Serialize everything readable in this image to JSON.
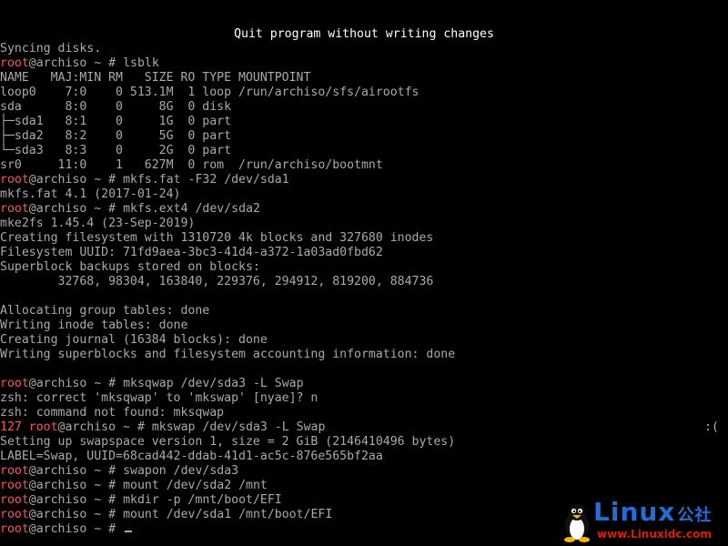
{
  "title": "Quit program without writing changes",
  "prompt": {
    "user": "root",
    "at_host": "@archiso",
    "tilde": "~",
    "symbol": "#"
  },
  "colors": {
    "background": "#000000",
    "text": "#aaaaaa",
    "title": "#ffffff",
    "root_user": "#ff5555",
    "exit_code": "#ff5555",
    "watermark_blue": "#1f6fd6",
    "watermark_red": "#d81e06"
  },
  "lines": [
    {
      "type": "out",
      "text": "Syncing disks."
    },
    {
      "type": "cmd",
      "cmd": "lsblk"
    },
    {
      "type": "out",
      "text": "NAME   MAJ:MIN RM   SIZE RO TYPE MOUNTPOINT"
    },
    {
      "type": "out",
      "text": "loop0    7:0    0 513.1M  1 loop /run/archiso/sfs/airootfs"
    },
    {
      "type": "out",
      "text": "sda      8:0    0     8G  0 disk"
    },
    {
      "type": "out",
      "text": "├─sda1   8:1    0     1G  0 part"
    },
    {
      "type": "out",
      "text": "├─sda2   8:2    0     5G  0 part"
    },
    {
      "type": "out",
      "text": "└─sda3   8:3    0     2G  0 part"
    },
    {
      "type": "out",
      "text": "sr0     11:0    1   627M  0 rom  /run/archiso/bootmnt"
    },
    {
      "type": "cmd",
      "cmd": "mkfs.fat -F32 /dev/sda1"
    },
    {
      "type": "out",
      "text": "mkfs.fat 4.1 (2017-01-24)"
    },
    {
      "type": "cmd",
      "cmd": "mkfs.ext4 /dev/sda2"
    },
    {
      "type": "out",
      "text": "mke2fs 1.45.4 (23-Sep-2019)"
    },
    {
      "type": "out",
      "text": "Creating filesystem with 1310720 4k blocks and 327680 inodes"
    },
    {
      "type": "out",
      "text": "Filesystem UUID: 71fd9aea-3bc3-41d4-a372-1a03ad0fbd62"
    },
    {
      "type": "out",
      "text": "Superblock backups stored on blocks:"
    },
    {
      "type": "out",
      "text": "        32768, 98304, 163840, 229376, 294912, 819200, 884736"
    },
    {
      "type": "out",
      "text": ""
    },
    {
      "type": "out",
      "text": "Allocating group tables: done"
    },
    {
      "type": "out",
      "text": "Writing inode tables: done"
    },
    {
      "type": "out",
      "text": "Creating journal (16384 blocks): done"
    },
    {
      "type": "out",
      "text": "Writing superblocks and filesystem accounting information: done"
    },
    {
      "type": "out",
      "text": ""
    },
    {
      "type": "cmd",
      "cmd": "mksqwap /dev/sda3 -L Swap"
    },
    {
      "type": "out",
      "text": "zsh: correct 'mksqwap' to 'mkswap' [nyae]? n"
    },
    {
      "type": "out",
      "text": "zsh: command not found: mksqwap"
    },
    {
      "type": "cmd",
      "code": "127",
      "cmd": "mkswap /dev/sda3 -L Swap",
      "rprompt": ":("
    },
    {
      "type": "out",
      "text": "Setting up swapspace version 1, size = 2 GiB (2146410496 bytes)"
    },
    {
      "type": "out",
      "text": "LABEL=Swap, UUID=68cad442-ddab-41d1-ac5c-876e565bf2aa"
    },
    {
      "type": "cmd",
      "cmd": "swapon /dev/sda3"
    },
    {
      "type": "cmd",
      "cmd": "mount /dev/sda2 /mnt"
    },
    {
      "type": "cmd",
      "cmd": "mkdir -p /mnt/boot/EFI"
    },
    {
      "type": "cmd",
      "cmd": "mount /dev/sda1 /mnt/boot/EFI"
    },
    {
      "type": "cmd",
      "cmd": "",
      "cursor": true
    }
  ],
  "watermark": {
    "brand": "Linux",
    "brand_cn": "公社",
    "url": "www.Linuxidc.com",
    "icon": "tux-penguin-icon"
  }
}
